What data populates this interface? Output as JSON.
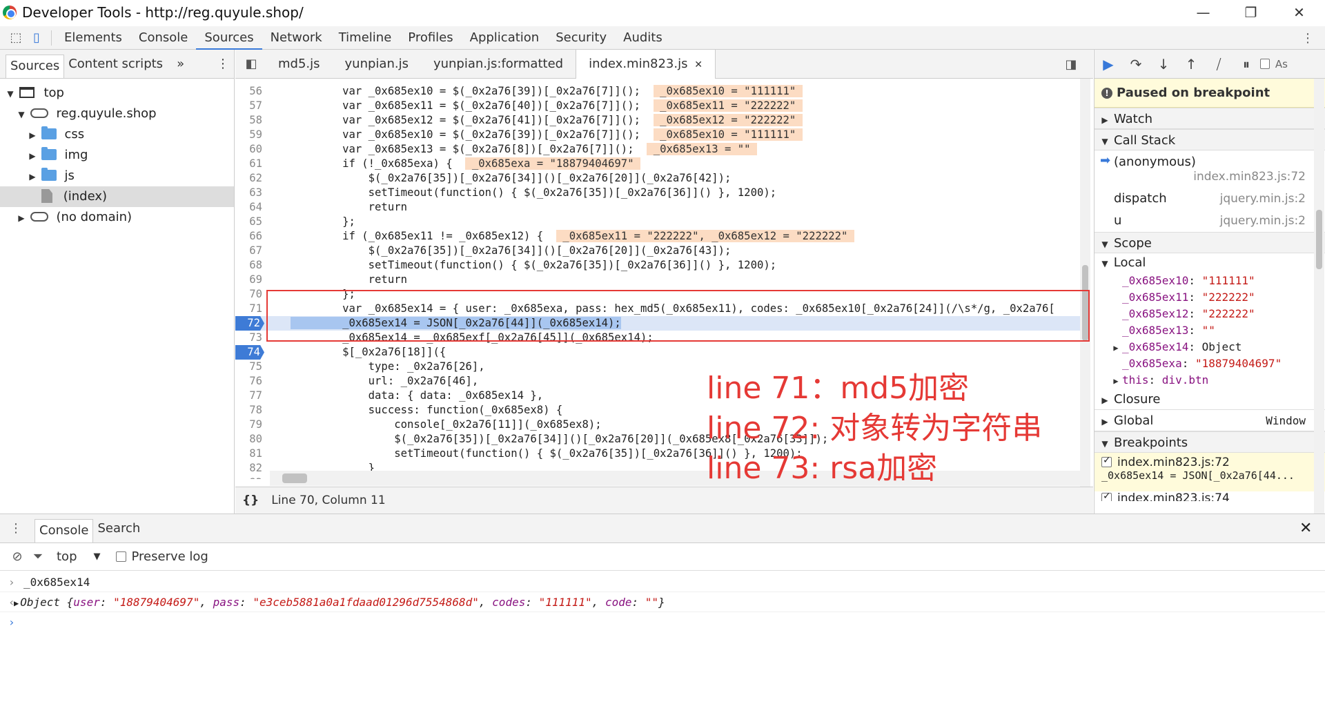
{
  "window": {
    "title": "Developer Tools - http://reg.quyule.shop/",
    "minimize": "—",
    "restore": "❐",
    "close": "✕"
  },
  "main_tabs": [
    "Elements",
    "Console",
    "Sources",
    "Network",
    "Timeline",
    "Profiles",
    "Application",
    "Security",
    "Audits"
  ],
  "main_tabs_active": "Sources",
  "left": {
    "tabs": [
      "Sources",
      "Content scripts"
    ],
    "more": "»",
    "menu": "⋮",
    "tree": {
      "top": "top",
      "domain": "reg.quyule.shop",
      "css": "css",
      "img": "img",
      "js": "js",
      "index": "(index)",
      "no_domain": "(no domain)"
    }
  },
  "editor": {
    "tabs": [
      "md5.js",
      "yunpian.js",
      "yunpian.js:formatted",
      "index.min823.js"
    ],
    "tab_close": "✕",
    "status": "Line 70, Column 11",
    "pretty": "{}",
    "lines": [
      {
        "n": "56",
        "t": "        var _0x685ex10 = $(_0x2a76[39])[_0x2a76[7]]();  ",
        "inl": " _0x685ex10 = \"111111\" "
      },
      {
        "n": "57",
        "t": "        var _0x685ex11 = $(_0x2a76[40])[_0x2a76[7]]();  ",
        "inl": " _0x685ex11 = \"222222\" "
      },
      {
        "n": "58",
        "t": "        var _0x685ex12 = $(_0x2a76[41])[_0x2a76[7]]();  ",
        "inl": " _0x685ex12 = \"222222\" "
      },
      {
        "n": "59",
        "t": "        var _0x685ex10 = $(_0x2a76[39])[_0x2a76[7]]();  ",
        "inl": " _0x685ex10 = \"111111\" "
      },
      {
        "n": "60",
        "t": "        var _0x685ex13 = $(_0x2a76[8])[_0x2a76[7]]();  ",
        "inl": " _0x685ex13 = \"\" "
      },
      {
        "n": "61",
        "t": "        if (!_0x685exa) {  ",
        "inl": " _0x685exa = \"18879404697\" "
      },
      {
        "n": "62",
        "t": "            $(_0x2a76[35])[_0x2a76[34]]()[_0x2a76[20]](_0x2a76[42]);",
        "inl": ""
      },
      {
        "n": "63",
        "t": "            setTimeout(function() { $(_0x2a76[35])[_0x2a76[36]]() }, 1200);",
        "inl": ""
      },
      {
        "n": "64",
        "t": "            return",
        "inl": ""
      },
      {
        "n": "65",
        "t": "        };",
        "inl": ""
      },
      {
        "n": "66",
        "t": "        if (_0x685ex11 != _0x685ex12) {  ",
        "inl": " _0x685ex11 = \"222222\", _0x685ex12 = \"222222\" "
      },
      {
        "n": "67",
        "t": "            $(_0x2a76[35])[_0x2a76[34]]()[_0x2a76[20]](_0x2a76[43]);",
        "inl": ""
      },
      {
        "n": "68",
        "t": "            setTimeout(function() { $(_0x2a76[35])[_0x2a76[36]]() }, 1200);",
        "inl": ""
      },
      {
        "n": "69",
        "t": "            return",
        "inl": ""
      },
      {
        "n": "70",
        "t": "        };",
        "inl": ""
      },
      {
        "n": "71",
        "t": "        var _0x685ex14 = { user: _0x685exa, pass: hex_md5(_0x685ex11), codes: _0x685ex10[_0x2a76[24]](/\\s*/g, _0x2a76[",
        "inl": ""
      },
      {
        "n": "72",
        "t": "        _0x685ex14 = JSON[_0x2a76[44]](_0x685ex14);",
        "inl": ""
      },
      {
        "n": "73",
        "t": "        _0x685ex14 = _0x685exf[_0x2a76[45]](_0x685ex14);",
        "inl": ""
      },
      {
        "n": "74",
        "t": "        $[_0x2a76[18]]({",
        "inl": ""
      },
      {
        "n": "75",
        "t": "            type: _0x2a76[26],",
        "inl": ""
      },
      {
        "n": "76",
        "t": "            url: _0x2a76[46],",
        "inl": ""
      },
      {
        "n": "77",
        "t": "            data: { data: _0x685ex14 },",
        "inl": ""
      },
      {
        "n": "78",
        "t": "            success: function(_0x685ex8) {",
        "inl": ""
      },
      {
        "n": "79",
        "t": "                console[_0x2a76[11]](_0x685ex8);",
        "inl": ""
      },
      {
        "n": "80",
        "t": "                $(_0x2a76[35])[_0x2a76[34]]()[_0x2a76[20]](_0x685ex8[_0x2a76[33]]);",
        "inl": ""
      },
      {
        "n": "81",
        "t": "                setTimeout(function() { $(_0x2a76[35])[_0x2a76[36]]() }, 1200);",
        "inl": ""
      },
      {
        "n": "82",
        "t": "            }",
        "inl": ""
      },
      {
        "n": "83",
        "t": "",
        "inl": ""
      }
    ],
    "breakpoint_lines": [
      "72",
      "74"
    ],
    "current_line": "72",
    "annotations": [
      "line 71：md5加密",
      "line 72:   对象转为字符串",
      "line 73: rsa加密"
    ]
  },
  "debugger": {
    "paused": "Paused on breakpoint",
    "watch": "Watch",
    "call_stack": "Call Stack",
    "stack": [
      {
        "fn": "(anonymous)",
        "loc": "index.min823.js:72"
      },
      {
        "fn": "dispatch",
        "loc": "jquery.min.js:2"
      },
      {
        "fn": "u",
        "loc": "jquery.min.js:2"
      }
    ],
    "scope": "Scope",
    "local": "Local",
    "locals": [
      {
        "k": "_0x685ex10",
        "v": "\"111111\""
      },
      {
        "k": "_0x685ex11",
        "v": "\"222222\""
      },
      {
        "k": "_0x685ex12",
        "v": "\"222222\""
      },
      {
        "k": "_0x685ex13",
        "v": "\"\""
      },
      {
        "k": "_0x685ex14",
        "v": "Object"
      },
      {
        "k": "_0x685exa",
        "v": "\"18879404697\""
      },
      {
        "k": "this",
        "v": "div.btn"
      }
    ],
    "closure": "Closure",
    "global": "Global",
    "global_val": "Window",
    "breakpoints": "Breakpoints",
    "bp1_loc": "index.min823.js:72",
    "bp1_code": "_0x685ex14 = JSON[_0x2a76[44...",
    "bp2_loc": "index.min823.js:74",
    "async_label": "As"
  },
  "console": {
    "tabs": [
      "Console",
      "Search"
    ],
    "close": "✕",
    "context": "top",
    "preserve_log": "Preserve log",
    "input_echo": "_0x685ex14",
    "result_prefix": "Object",
    "result": {
      "user": "\"18879404697\"",
      "pass": "\"e3ceb5881a0a1fdaad01296d7554868d\"",
      "codes": "\"111111\"",
      "code": "\"\""
    }
  },
  "colors": {
    "accent": "#3879d9",
    "annotation": "#e53935",
    "inline_value_bg": "#fcdcc3",
    "paused_bg": "#fffbdb"
  }
}
